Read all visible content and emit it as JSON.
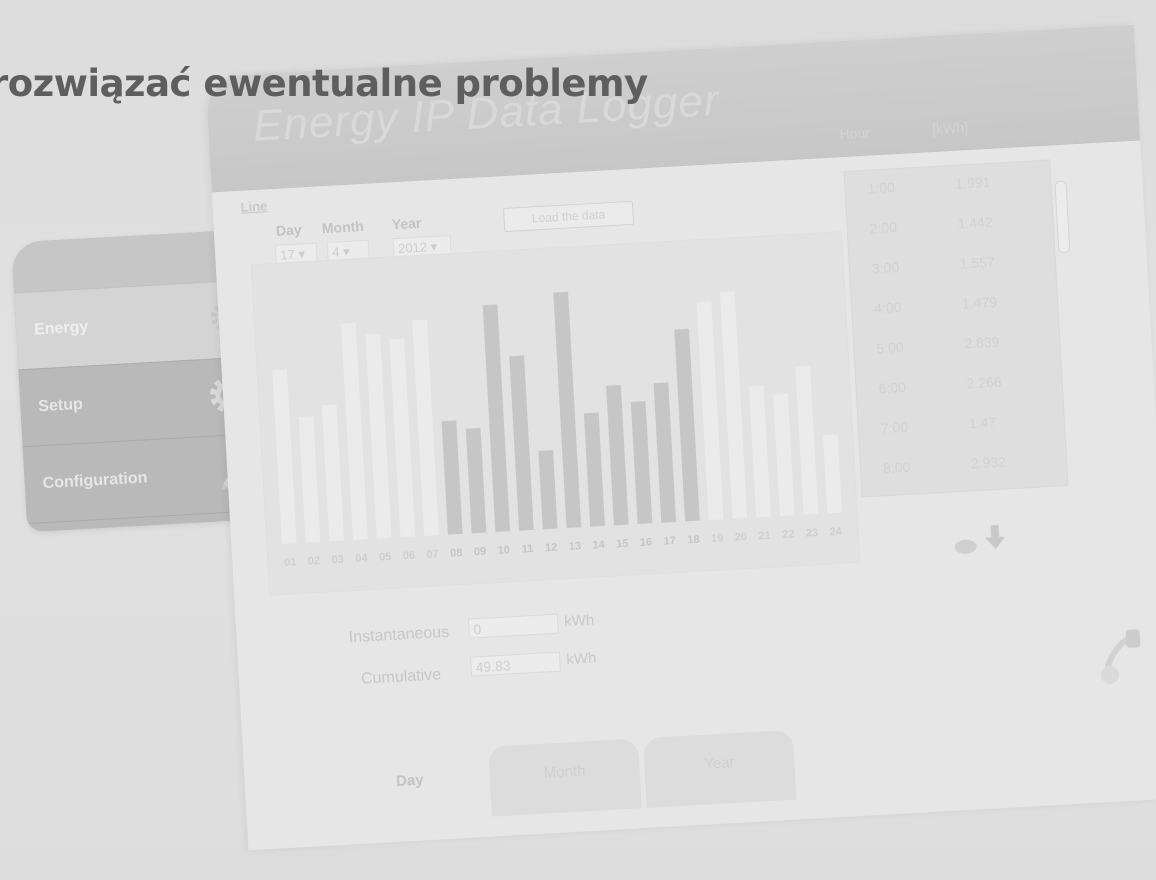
{
  "page_title": "rozwiązać ewentualne problemy",
  "app": {
    "title": "Energy IP Data Logger"
  },
  "sidebar": {
    "items": [
      {
        "label": "Energy",
        "icon": "energy-gear-icon"
      },
      {
        "label": "Setup",
        "icon": "gear-icon"
      },
      {
        "label": "Configuration",
        "icon": "pencil-icon"
      }
    ],
    "active": "Energy"
  },
  "controls": {
    "line_link": "Line",
    "day_label": "Day",
    "month_label": "Month",
    "year_label": "Year",
    "day_value": "17",
    "month_value": "4",
    "year_value": "2012",
    "load_button": "Load the data"
  },
  "table": {
    "col_hour": "Hour",
    "col_kwh": "[kWh]",
    "rows": [
      {
        "hour": "1:00",
        "kwh": "1.991"
      },
      {
        "hour": "2:00",
        "kwh": "1.442"
      },
      {
        "hour": "3:00",
        "kwh": "1.557"
      },
      {
        "hour": "4:00",
        "kwh": "1.479"
      },
      {
        "hour": "5:00",
        "kwh": "2.839"
      },
      {
        "hour": "6:00",
        "kwh": "2.266"
      },
      {
        "hour": "7:00",
        "kwh": "1.47"
      },
      {
        "hour": "8:00",
        "kwh": "2.932"
      }
    ]
  },
  "meters": {
    "instantaneous_label": "Instantaneous",
    "instantaneous_value": "0",
    "cumulative_label": "Cumulative",
    "cumulative_value": "49.83",
    "unit": "kWh"
  },
  "tabs": [
    "Day",
    "Month",
    "Year"
  ],
  "active_tab": "Day",
  "chart_data": {
    "type": "bar",
    "categories": [
      "01",
      "02",
      "03",
      "04",
      "05",
      "06",
      "07",
      "08",
      "09",
      "10",
      "11",
      "12",
      "13",
      "14",
      "15",
      "16",
      "17",
      "18",
      "19",
      "20",
      "21",
      "22",
      "23",
      "24"
    ],
    "values": [
      1.99,
      1.44,
      1.56,
      2.48,
      2.34,
      2.27,
      2.47,
      1.3,
      1.2,
      2.6,
      2.0,
      0.9,
      2.7,
      1.3,
      1.6,
      1.4,
      1.6,
      2.2,
      2.5,
      2.6,
      1.5,
      1.4,
      1.7,
      0.9
    ],
    "highlighted": [
      "08",
      "09",
      "10",
      "11",
      "12",
      "13",
      "14",
      "15",
      "16",
      "17",
      "18"
    ],
    "ylim": [
      0,
      3
    ]
  }
}
